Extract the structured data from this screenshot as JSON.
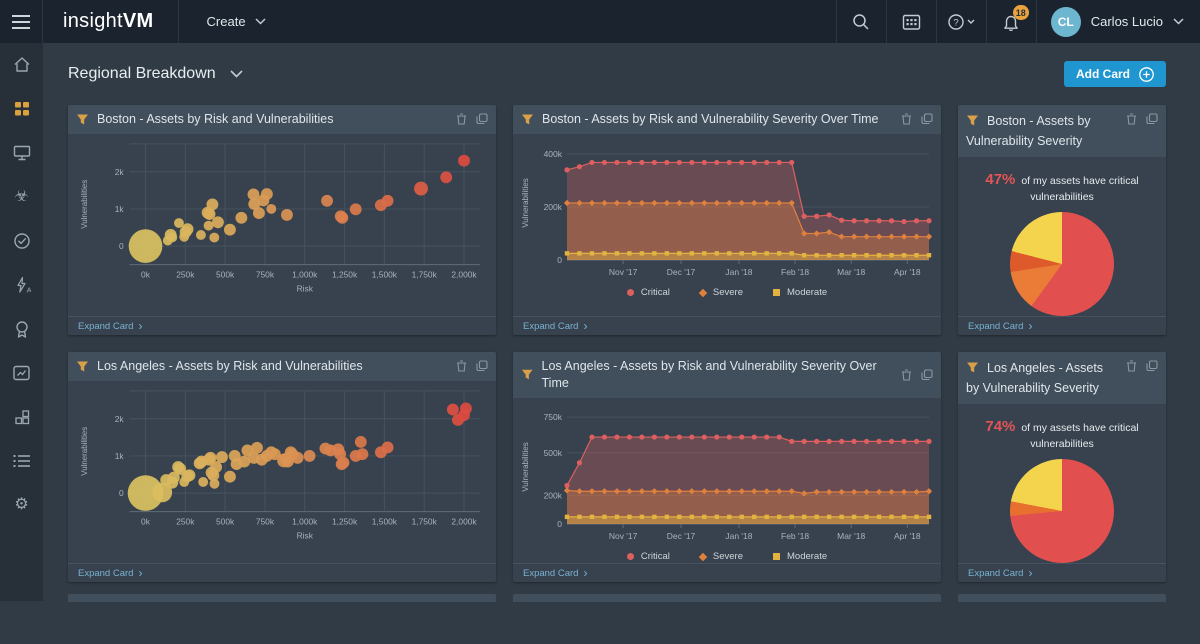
{
  "navbar": {
    "logo_light": "insight",
    "logo_bold": "VM",
    "create_label": "Create",
    "notification_count": "18",
    "user_initials": "CL",
    "user_name": "Carlos Lucio"
  },
  "sidebar": {
    "items": [
      "home",
      "dashboards",
      "assets",
      "vulnerabilities",
      "policies",
      "automated-actions",
      "goals",
      "reports",
      "console",
      "management",
      "settings"
    ],
    "active_item": "dashboards"
  },
  "page": {
    "title": "Regional Breakdown",
    "add_card_label": "Add Card"
  },
  "ui": {
    "expand_label": "Expand Card",
    "expand_chevron": "›"
  },
  "colors": {
    "accent_blue": "#1f96cf",
    "critical": "#dd5f5f",
    "severe": "#df803e",
    "moderate": "#e3b341",
    "active_icon": "#dba13d",
    "stat_red": "#e35555"
  },
  "cards": [
    {
      "title": "Boston - Assets by Risk and Vulnerabilities"
    },
    {
      "title": "Boston - Assets by Risk and Vulnerability Severity Over Time"
    },
    {
      "title": "Boston - Assets by Vulnerability Severity"
    },
    {
      "title": "Los Angeles - Assets by Risk and Vulnerabilities"
    },
    {
      "title": "Los Angeles - Assets by Risk and Vulnerability Severity Over Time"
    },
    {
      "title": "Los Angeles - Assets by Vulnerability Severity"
    }
  ],
  "chart_data": [
    {
      "type": "scatter",
      "title": "Boston - Assets by Risk and Vulnerabilities",
      "xlabel": "Risk",
      "ylabel": "Vulnerabilities",
      "xlim": [
        -100,
        2100
      ],
      "ylim": [
        -500,
        2750
      ],
      "xticks": [
        0,
        250,
        500,
        750,
        1000,
        1250,
        1500,
        1750,
        2000
      ],
      "xtick_labels": [
        "0k",
        "250k",
        "500k",
        "750k",
        "1,000k",
        "1,250k",
        "1,500k",
        "1,750k",
        "2,000k"
      ],
      "yticks": [
        0,
        1000,
        2000
      ],
      "ytick_labels": [
        "0",
        "1k",
        "2k"
      ],
      "points": [
        [
          0,
          0,
          17
        ],
        [
          140,
          150,
          5
        ],
        [
          158,
          300,
          6
        ],
        [
          168,
          235,
          5
        ],
        [
          210,
          620,
          5
        ],
        [
          243,
          250,
          5
        ],
        [
          252,
          380,
          6
        ],
        [
          264,
          455,
          6
        ],
        [
          348,
          300,
          5
        ],
        [
          390,
          900,
          6
        ],
        [
          402,
          862,
          6
        ],
        [
          396,
          550,
          5
        ],
        [
          420,
          1120,
          6
        ],
        [
          432,
          230,
          5
        ],
        [
          455,
          640,
          6
        ],
        [
          530,
          440,
          6
        ],
        [
          602,
          760,
          6
        ],
        [
          678,
          1390,
          6
        ],
        [
          683,
          1130,
          6
        ],
        [
          712,
          888,
          6
        ],
        [
          740,
          1228,
          6
        ],
        [
          762,
          1400,
          6
        ],
        [
          790,
          1000,
          5
        ],
        [
          888,
          840,
          6
        ],
        [
          1140,
          1218,
          6
        ],
        [
          1226,
          800,
          6
        ],
        [
          1236,
          762,
          6
        ],
        [
          1320,
          990,
          6
        ],
        [
          1478,
          1100,
          6
        ],
        [
          1520,
          1218,
          6
        ],
        [
          1730,
          1548,
          7
        ],
        [
          1888,
          1850,
          6
        ],
        [
          2000,
          2300,
          6
        ]
      ]
    },
    {
      "type": "area-time",
      "title": "Boston - Assets by Risk and Vulnerability Severity Over Time",
      "ylabel": "Vulnerabilities",
      "ymax": 430,
      "yticks": [
        0,
        200,
        400
      ],
      "ytick_labels": [
        "0",
        "200k",
        "400k"
      ],
      "xticks": [
        {
          "f": 0.155,
          "label": "Nov '17"
        },
        {
          "f": 0.315,
          "label": "Dec '17"
        },
        {
          "f": 0.475,
          "label": "Jan '18"
        },
        {
          "f": 0.63,
          "label": "Feb '18"
        },
        {
          "f": 0.785,
          "label": "Mar '18"
        },
        {
          "f": 0.94,
          "label": "Apr '18"
        }
      ],
      "legend": [
        {
          "label": "Critical",
          "marker": "circle",
          "color": "#dd5f5f"
        },
        {
          "label": "Severe",
          "marker": "diamond",
          "color": "#df803e"
        },
        {
          "label": "Moderate",
          "marker": "square",
          "color": "#e3b341"
        }
      ],
      "series": [
        {
          "name": "Critical",
          "color": "#dd5f5f",
          "marker": "circle",
          "values": [
            340,
            352,
            368,
            368,
            368,
            368,
            368,
            368,
            368,
            368,
            368,
            368,
            368,
            368,
            368,
            368,
            368,
            368,
            368,
            165,
            165,
            170,
            150,
            148,
            148,
            148,
            148,
            145,
            148,
            148
          ]
        },
        {
          "name": "Severe",
          "color": "#df803e",
          "marker": "diamond",
          "values": [
            215,
            215,
            215,
            215,
            215,
            215,
            215,
            215,
            215,
            215,
            215,
            215,
            215,
            215,
            215,
            215,
            215,
            215,
            215,
            100,
            100,
            105,
            88,
            88,
            88,
            88,
            88,
            88,
            88,
            88
          ]
        },
        {
          "name": "Moderate",
          "color": "#e3b341",
          "marker": "square",
          "values": [
            25,
            25,
            25,
            25,
            25,
            25,
            25,
            25,
            25,
            25,
            25,
            25,
            25,
            25,
            25,
            25,
            25,
            25,
            25,
            18,
            18,
            18,
            18,
            18,
            18,
            18,
            18,
            18,
            18,
            18
          ]
        }
      ]
    },
    {
      "type": "pie",
      "title": "Boston - Assets by Vulnerability Severity",
      "stat_value": "47%",
      "stat_text": "of my assets have critical vulnerabilities",
      "slices": [
        {
          "value": 60,
          "color": "#e14f4f"
        },
        {
          "value": 12.5,
          "color": "#ea7c38"
        },
        {
          "value": 6.5,
          "color": "#df5a2b"
        },
        {
          "value": 21,
          "color": "#f5d44d"
        }
      ]
    },
    {
      "type": "scatter",
      "title": "Los Angeles - Assets by Risk and Vulnerabilities",
      "xlabel": "Risk",
      "ylabel": "Vulnerabilities",
      "xlim": [
        -100,
        2100
      ],
      "ylim": [
        -500,
        2750
      ],
      "xticks": [
        0,
        250,
        500,
        750,
        1000,
        1250,
        1500,
        1750,
        2000
      ],
      "xtick_labels": [
        "0k",
        "250k",
        "500k",
        "750k",
        "1,000k",
        "1,250k",
        "1,500k",
        "1,750k",
        "2,000k"
      ],
      "yticks": [
        0,
        1000,
        2000
      ],
      "ytick_labels": [
        "0",
        "1k",
        "2k"
      ],
      "points": [
        [
          0,
          0,
          18
        ],
        [
          105,
          20,
          10
        ],
        [
          130,
          350,
          6
        ],
        [
          168,
          280,
          6
        ],
        [
          178,
          418,
          6
        ],
        [
          205,
          700,
          6
        ],
        [
          218,
          650,
          6
        ],
        [
          243,
          300,
          5
        ],
        [
          262,
          450,
          6
        ],
        [
          276,
          478,
          6
        ],
        [
          340,
          800,
          6
        ],
        [
          352,
          848,
          6
        ],
        [
          362,
          300,
          5
        ],
        [
          398,
          900,
          6
        ],
        [
          408,
          948,
          6
        ],
        [
          415,
          550,
          6
        ],
        [
          426,
          478,
          6
        ],
        [
          433,
          250,
          5
        ],
        [
          443,
          700,
          6
        ],
        [
          480,
          968,
          6
        ],
        [
          530,
          440,
          6
        ],
        [
          560,
          1000,
          6
        ],
        [
          572,
          780,
          6
        ],
        [
          620,
          848,
          6
        ],
        [
          640,
          1148,
          6
        ],
        [
          680,
          948,
          6
        ],
        [
          700,
          1218,
          6
        ],
        [
          730,
          900,
          6
        ],
        [
          762,
          1000,
          6
        ],
        [
          790,
          1098,
          6
        ],
        [
          812,
          1048,
          6
        ],
        [
          870,
          878,
          7
        ],
        [
          882,
          918,
          6
        ],
        [
          893,
          848,
          6
        ],
        [
          912,
          1098,
          6
        ],
        [
          922,
          1048,
          6
        ],
        [
          955,
          948,
          6
        ],
        [
          1030,
          1000,
          6
        ],
        [
          1130,
          1198,
          6
        ],
        [
          1162,
          1148,
          6
        ],
        [
          1210,
          1178,
          6
        ],
        [
          1222,
          1048,
          6
        ],
        [
          1232,
          778,
          6
        ],
        [
          1243,
          818,
          6
        ],
        [
          1320,
          1000,
          6
        ],
        [
          1352,
          1378,
          6
        ],
        [
          1362,
          1048,
          6
        ],
        [
          1478,
          1098,
          6
        ],
        [
          1520,
          1228,
          6
        ],
        [
          1930,
          2248,
          6
        ],
        [
          1962,
          1968,
          6
        ],
        [
          2000,
          2098,
          6
        ],
        [
          2012,
          2278,
          6
        ]
      ]
    },
    {
      "type": "area-time",
      "title": "Los Angeles - Assets by Risk and Vulnerability Severity Over Time",
      "ylabel": "Vulnerabilities",
      "ymax": 800,
      "yticks": [
        0,
        200,
        500,
        750
      ],
      "ytick_labels": [
        "0",
        "200k",
        "500k",
        "750k"
      ],
      "xticks": [
        {
          "f": 0.155,
          "label": "Nov '17"
        },
        {
          "f": 0.315,
          "label": "Dec '17"
        },
        {
          "f": 0.475,
          "label": "Jan '18"
        },
        {
          "f": 0.63,
          "label": "Feb '18"
        },
        {
          "f": 0.785,
          "label": "Mar '18"
        },
        {
          "f": 0.94,
          "label": "Apr '18"
        }
      ],
      "legend": [
        {
          "label": "Critical",
          "marker": "circle",
          "color": "#dd5f5f"
        },
        {
          "label": "Severe",
          "marker": "diamond",
          "color": "#df803e"
        },
        {
          "label": "Moderate",
          "marker": "square",
          "color": "#e3b341"
        }
      ],
      "series": [
        {
          "name": "Critical",
          "color": "#dd5f5f",
          "marker": "circle",
          "values": [
            270,
            430,
            610,
            610,
            610,
            610,
            610,
            610,
            610,
            610,
            610,
            610,
            610,
            610,
            610,
            610,
            610,
            610,
            580,
            580,
            580,
            580,
            580,
            580,
            580,
            580,
            580,
            580,
            580,
            580
          ]
        },
        {
          "name": "Severe",
          "color": "#df803e",
          "marker": "diamond",
          "values": [
            235,
            230,
            230,
            230,
            230,
            230,
            230,
            230,
            230,
            230,
            230,
            230,
            230,
            230,
            230,
            230,
            230,
            230,
            230,
            215,
            225,
            225,
            225,
            225,
            225,
            225,
            225,
            225,
            225,
            230
          ]
        },
        {
          "name": "Moderate",
          "color": "#e3b341",
          "marker": "square",
          "values": [
            50,
            50,
            50,
            50,
            50,
            50,
            50,
            50,
            50,
            50,
            50,
            50,
            50,
            50,
            50,
            50,
            50,
            50,
            50,
            50,
            50,
            50,
            50,
            50,
            50,
            50,
            50,
            50,
            50,
            50
          ]
        }
      ]
    },
    {
      "type": "pie",
      "title": "Los Angeles - Assets by Vulnerability Severity",
      "stat_value": "74%",
      "stat_text": "of my assets have critical vulnerabilities",
      "slices": [
        {
          "value": 73.5,
          "color": "#e14f4f"
        },
        {
          "value": 4.5,
          "color": "#e8702e"
        },
        {
          "value": 22,
          "color": "#f5d44d"
        }
      ]
    }
  ]
}
